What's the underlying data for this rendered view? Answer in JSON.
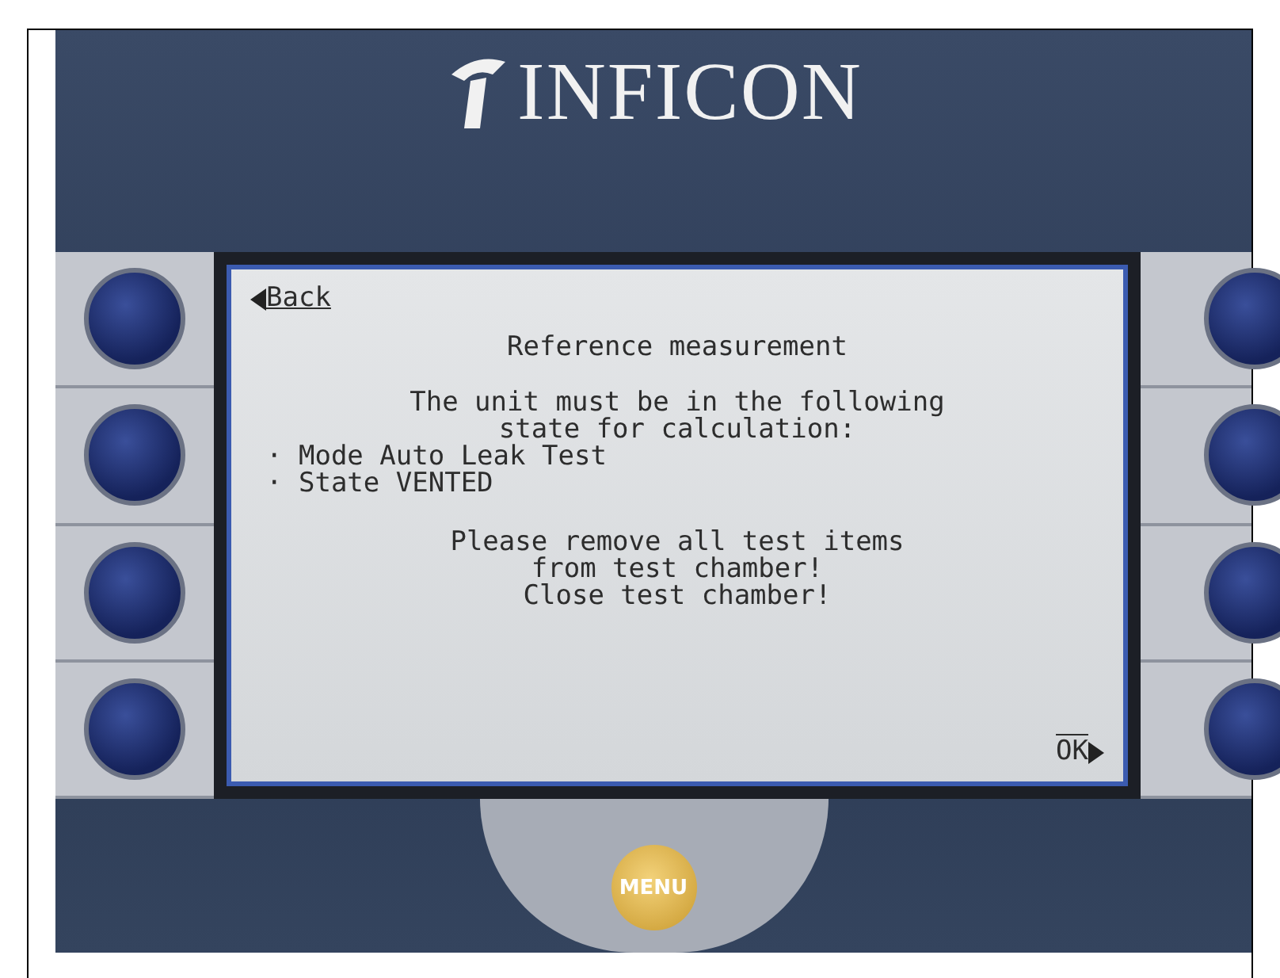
{
  "logo": {
    "text": "INFICON"
  },
  "screen": {
    "back": "Back",
    "title": "Reference measurement",
    "lines": [
      "The unit must be in the following",
      "state for calculation:"
    ],
    "bullets": [
      "· Mode Auto Leak Test",
      "· State VENTED"
    ],
    "instructions": [
      "Please remove all test items",
      "from test chamber!",
      "Close test chamber!"
    ],
    "ok": "OK"
  },
  "menu": {
    "label": "MENU"
  }
}
